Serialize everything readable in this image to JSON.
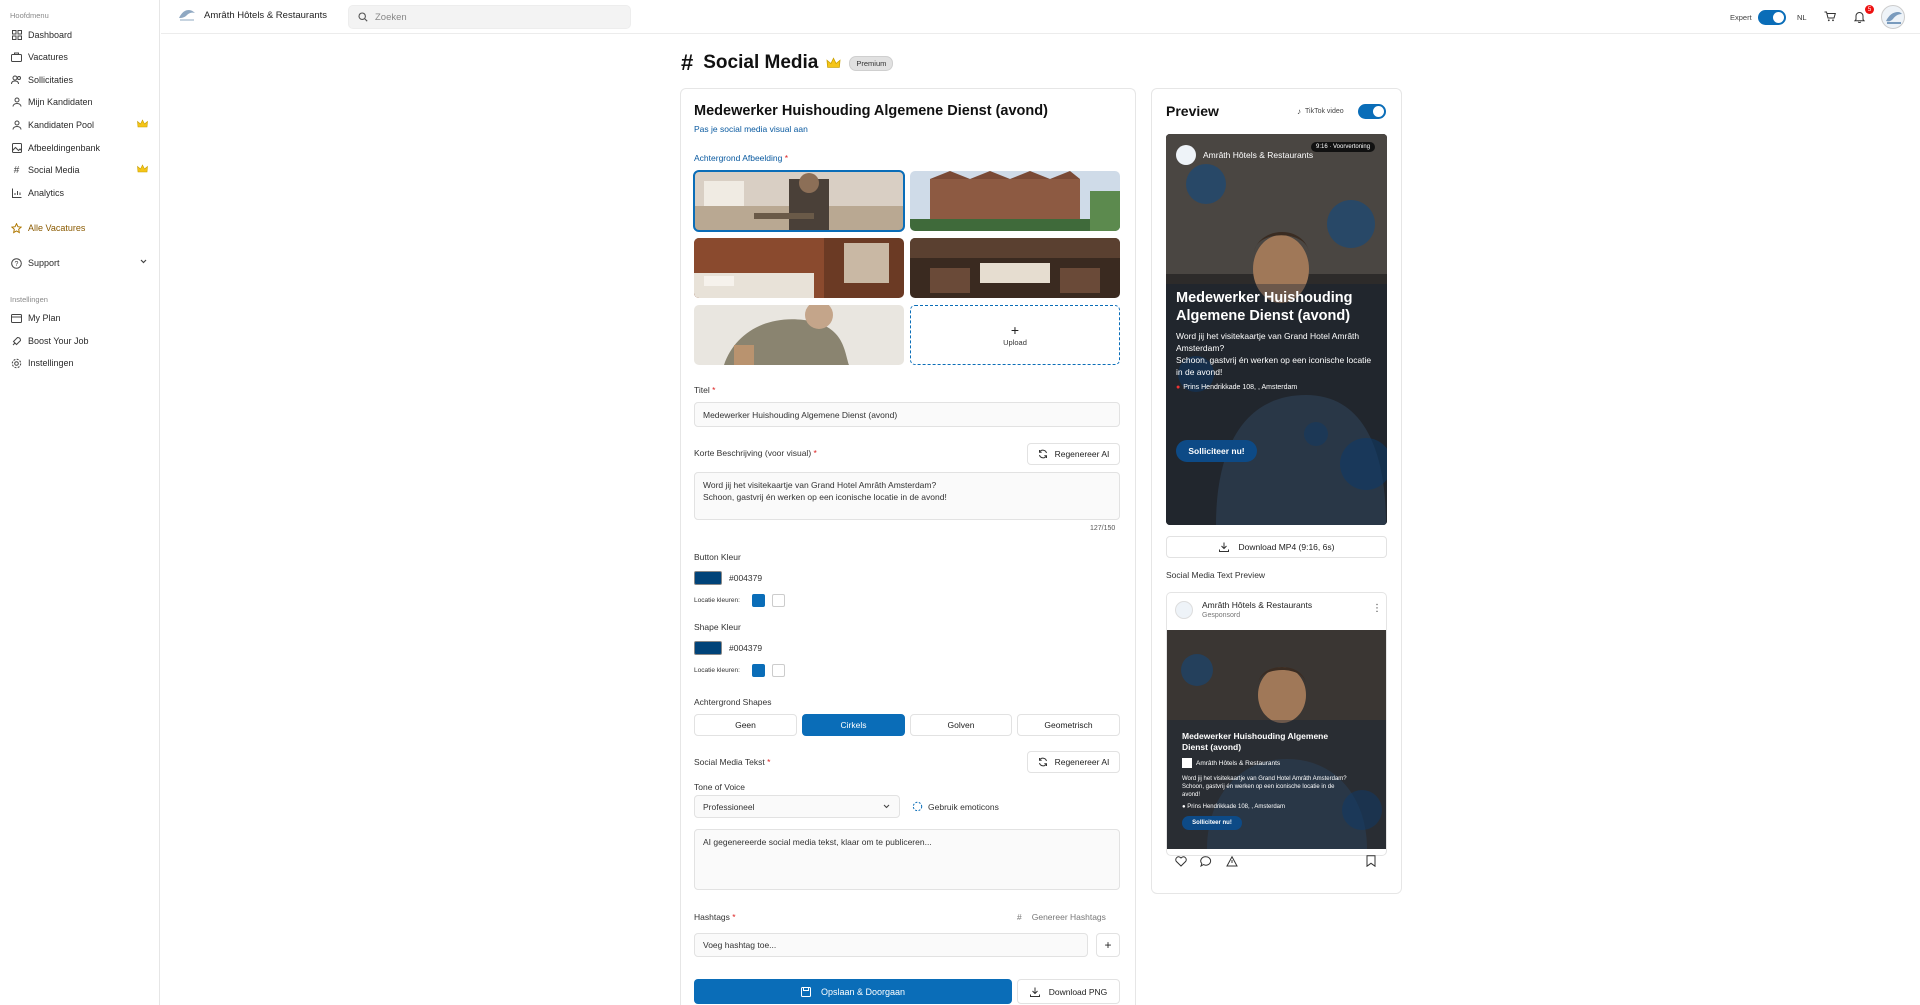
{
  "sidebar": {
    "section_main": "Hoofdmenu",
    "items": [
      {
        "label": "Dashboard",
        "icon": "grid-icon"
      },
      {
        "label": "Vacatures",
        "icon": "briefcase-icon"
      },
      {
        "label": "Sollicitaties",
        "icon": "users-icon"
      },
      {
        "label": "Mijn Kandidaten",
        "icon": "user-icon"
      },
      {
        "label": "Kandidaten Pool",
        "icon": "user-icon",
        "premium": true
      },
      {
        "label": "Afbeeldingenbank",
        "icon": "image-icon"
      },
      {
        "label": "Social Media",
        "icon": "hash-icon",
        "premium": true
      },
      {
        "label": "Analytics",
        "icon": "bar-chart-icon"
      }
    ],
    "all_vacancies": "Alle Vacatures",
    "support": "Support",
    "section_settings": "Instellingen",
    "settings_items": [
      {
        "label": "My Plan",
        "icon": "plan-icon"
      },
      {
        "label": "Boost Your Job",
        "icon": "rocket-icon"
      },
      {
        "label": "Instellingen",
        "icon": "gear-icon"
      }
    ]
  },
  "header": {
    "brand": "Amrâth Hôtels & Restaurants",
    "search_placeholder": "Zoeken",
    "expert_label": "Expert",
    "language": "NL",
    "notification_count": "5"
  },
  "page": {
    "title": "Social Media",
    "badge": "Premium"
  },
  "editor": {
    "job_title": "Medewerker Huishouding Algemene Dienst (avond)",
    "subtitle": "Pas je social media visual aan",
    "bg_image_label": "Achtergrond Afbeelding",
    "upload_label": "Upload",
    "title_label": "Titel",
    "title_value": "Medewerker Huishouding Algemene Dienst (avond)",
    "short_desc_label": "Korte Beschrijving (voor visual)",
    "regenerate_label": "Regenereer AI",
    "short_desc_line1": "Word jij het visitekaartje van Grand Hotel Amrâth Amsterdam?",
    "short_desc_line2": "Schoon, gastvrij én werken op een iconische locatie in de avond!",
    "char_count": "127/150",
    "button_color_label": "Button Kleur",
    "button_color_value": "#004379",
    "location_colors_label": "Locatie kleuren:",
    "shape_color_label": "Shape Kleur",
    "shape_color_value": "#004379",
    "shapes_label": "Achtergrond Shapes",
    "shapes": [
      "Geen",
      "Cirkels",
      "Golven",
      "Geometrisch"
    ],
    "social_text_label": "Social Media Tekst",
    "tone_label": "Tone of Voice",
    "tone_value": "Professioneel",
    "emoticons_label": "Gebruik emoticons",
    "social_text_placeholder": "AI gegenereerde social media tekst, klaar om te publiceren...",
    "hashtags_label": "Hashtags",
    "generate_hashtags": "Genereer Hashtags",
    "hashtag_placeholder": "Voeg hashtag toe...",
    "save_button": "Opslaan & Doorgaan",
    "download_png": "Download PNG"
  },
  "preview": {
    "title": "Preview",
    "tiktok_label": "TikTok video",
    "ratio_badge": "9:16 · Voorvertoning",
    "brand": "Amrâth Hôtels & Restaurants",
    "headline": "Medewerker Huishouding Algemene Dienst (avond)",
    "desc_line1": "Word jij het visitekaartje van Grand Hotel Amrâth Amsterdam?",
    "desc_line2": "Schoon, gastvrij én werken op een iconische locatie in de avond!",
    "address": "Prins Hendrikkade 108, , Amsterdam",
    "cta": "Solliciteer nu!",
    "download_mp4": "Download MP4 (9:16, 6s)",
    "text_preview_label": "Social Media Text Preview",
    "sponsored": "Gesponsord"
  },
  "colors": {
    "accent": "#0a6db8",
    "button_color": "#004379",
    "location_blue": "#0a6db8",
    "location_white": "#ffffff"
  }
}
